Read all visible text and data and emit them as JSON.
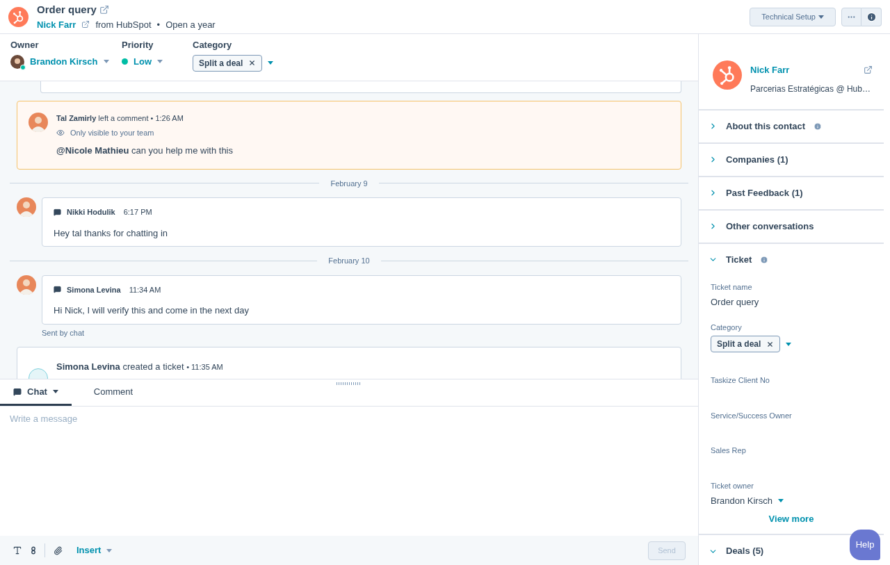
{
  "header": {
    "title": "Order query",
    "contact": "Nick Farr",
    "source": "from HubSpot",
    "separator": "•",
    "age": "Open a year",
    "menu_button": "Technical Setup"
  },
  "properties": {
    "owner": {
      "label": "Owner",
      "value": "Brandon Kirsch",
      "online": true
    },
    "priority": {
      "label": "Priority",
      "value": "Low",
      "color": "#00bda5"
    },
    "category": {
      "label": "Category",
      "tag": "Split a deal"
    }
  },
  "feed": [
    {
      "kind": "cut_card"
    },
    {
      "kind": "comment",
      "author": "Tal Zamirly",
      "action": "left a comment",
      "time": "• 1:26 AM",
      "visibility": "Only visible to your team",
      "body": "**@Nicole Mathieu** can you help me with this"
    },
    {
      "kind": "date",
      "label": "February 9"
    },
    {
      "kind": "message",
      "author": "Nikki Hodulik",
      "time": "6:17 PM",
      "body": "Hey tal thanks for chatting in"
    },
    {
      "kind": "date",
      "label": "February 10"
    },
    {
      "kind": "message",
      "author": "Simona Levina",
      "time": "11:34 AM",
      "body": "Hi Nick, I will verify this and come in the next day",
      "footer": "Sent by chat"
    },
    {
      "kind": "event",
      "author": "Simona Levina",
      "action": "created a ticket",
      "time": "• 11:35 AM"
    }
  ],
  "composer": {
    "tabs": [
      {
        "label": "Chat",
        "selected": true,
        "dropdown": true
      },
      {
        "label": "Comment",
        "selected": false,
        "dropdown": false
      }
    ],
    "placeholder": "Write a message",
    "insert": "Insert",
    "send": {
      "label": "Send",
      "disabled": true
    }
  },
  "sidebar": {
    "contact": {
      "name": "Nick Farr",
      "subtitle": "Parcerias Estratégicas @ Hub…"
    },
    "sections": [
      {
        "title": "About this contact",
        "expanded": false,
        "info": true
      },
      {
        "title": "Companies (1)",
        "expanded": false,
        "info": false
      },
      {
        "title": "Past Feedback (1)",
        "expanded": false,
        "info": false
      },
      {
        "title": "Other conversations",
        "expanded": false,
        "info": false
      },
      {
        "title": "Ticket",
        "expanded": true,
        "info": true,
        "fields": [
          {
            "label": "Ticket name",
            "kind": "text",
            "value": "Order query"
          },
          {
            "label": "Category",
            "kind": "tag",
            "value": "Split a deal"
          },
          {
            "label": "Taskize Client No",
            "kind": "empty"
          },
          {
            "label": "Service/Success Owner",
            "kind": "empty"
          },
          {
            "label": "Sales Rep",
            "kind": "empty"
          },
          {
            "label": "Ticket owner",
            "kind": "select",
            "value": "Brandon Kirsch"
          }
        ],
        "link": "View more"
      },
      {
        "title": "Deals (5)",
        "expanded": true,
        "info": false
      }
    ]
  },
  "help": "Help"
}
